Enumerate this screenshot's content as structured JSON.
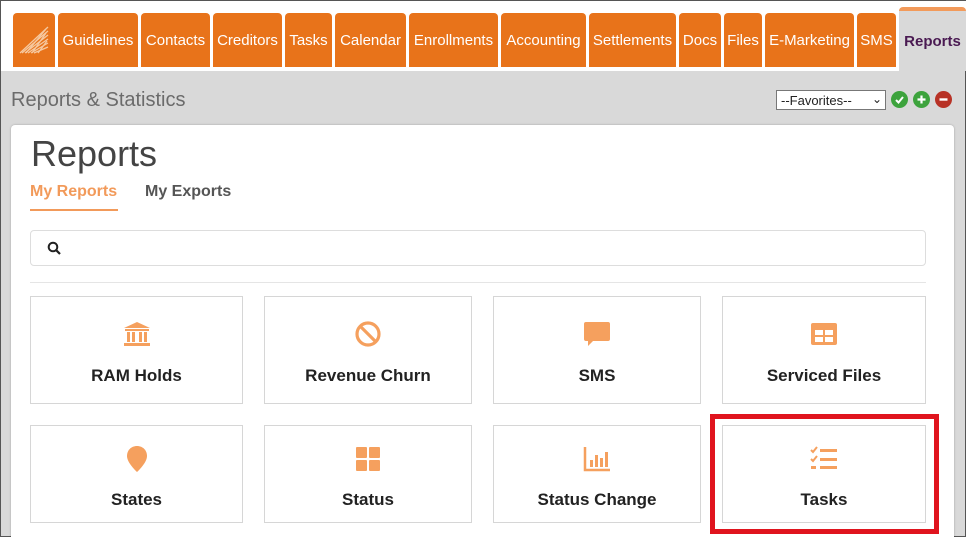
{
  "nav": {
    "tabs": [
      {
        "label": "Guidelines"
      },
      {
        "label": "Contacts"
      },
      {
        "label": "Creditors"
      },
      {
        "label": "Tasks"
      },
      {
        "label": "Calendar"
      },
      {
        "label": "Enrollments"
      },
      {
        "label": "Accounting"
      },
      {
        "label": "Settlements"
      },
      {
        "label": "Docs"
      },
      {
        "label": "Files"
      },
      {
        "label": "E-Marketing"
      },
      {
        "label": "SMS"
      },
      {
        "label": "Reports"
      }
    ],
    "active_tab": "Reports"
  },
  "header": {
    "title": "Reports & Statistics",
    "favorites_value": "--Favorites--"
  },
  "main": {
    "title": "Reports",
    "subtabs": [
      {
        "label": "My Reports"
      },
      {
        "label": "My Exports"
      }
    ],
    "active_subtab": "My Reports",
    "search_placeholder": "",
    "tiles": [
      {
        "label": "RAM Holds",
        "icon": "bank-icon"
      },
      {
        "label": "Revenue Churn",
        "icon": "ban-icon"
      },
      {
        "label": "SMS",
        "icon": "message-icon"
      },
      {
        "label": "Serviced Files",
        "icon": "table-icon"
      },
      {
        "label": "States",
        "icon": "map-pin-icon"
      },
      {
        "label": "Status",
        "icon": "grid-icon"
      },
      {
        "label": "Status Change",
        "icon": "bar-chart-icon"
      },
      {
        "label": "Tasks",
        "icon": "task-list-icon"
      }
    ],
    "highlighted_tile": "Tasks"
  },
  "colors": {
    "nav_orange": "#e8731a",
    "accent": "#f29a5a",
    "icon_orange": "#f5a05e",
    "highlight_red": "#e0141e"
  }
}
